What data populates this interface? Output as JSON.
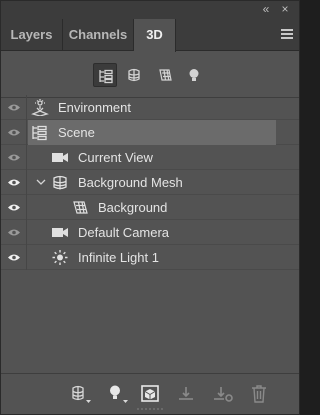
{
  "window": {
    "collapse_glyph": "«",
    "close_glyph": "×"
  },
  "tabs": [
    {
      "label": "Layers",
      "active": false
    },
    {
      "label": "Channels",
      "active": false
    },
    {
      "label": "3D",
      "active": true
    }
  ],
  "filters": [
    {
      "name": "whole-scene-filter",
      "icon": "scene-tree-icon",
      "active": true
    },
    {
      "name": "meshes-filter",
      "icon": "mesh-icon",
      "active": false
    },
    {
      "name": "materials-filter",
      "icon": "material-icon",
      "active": false
    },
    {
      "name": "lights-filter",
      "icon": "light-bulb-icon",
      "active": false
    }
  ],
  "scene_items": [
    {
      "label": "Environment",
      "icon": "environment-icon",
      "eye": "dim",
      "selected": false,
      "level": 0
    },
    {
      "label": "Scene",
      "icon": "scene-tree-icon",
      "eye": "dim",
      "selected": true,
      "level": 0
    },
    {
      "label": "Current View",
      "icon": "camera-icon",
      "eye": "dim",
      "selected": false,
      "level": 1
    },
    {
      "label": "Background Mesh",
      "icon": "mesh-icon",
      "eye": "bright",
      "selected": false,
      "level": 1,
      "expanded": true
    },
    {
      "label": "Background",
      "icon": "material-icon",
      "eye": "bright",
      "selected": false,
      "level": 2
    },
    {
      "label": "Default Camera",
      "icon": "camera-icon",
      "eye": "dim",
      "selected": false,
      "level": 1
    },
    {
      "label": "Infinite Light 1",
      "icon": "sun-light-icon",
      "eye": "bright",
      "selected": false,
      "level": 1
    }
  ],
  "toolbar": [
    {
      "name": "add-mesh-button",
      "icon": "mesh-icon"
    },
    {
      "name": "add-light-button",
      "icon": "light-bulb-icon"
    },
    {
      "name": "render-button",
      "icon": "render-cube-icon"
    },
    {
      "name": "drop-to-ground-button",
      "icon": "ground-icon"
    },
    {
      "name": "drop-to-ground-alt-button",
      "icon": "ground-plus-icon"
    },
    {
      "name": "delete-button",
      "icon": "trash-icon"
    }
  ],
  "colors": {
    "panel_bg": "#535353",
    "tab_bar_bg": "#3c3c3c",
    "selected_row": "#6b6b6b",
    "text": "#e4e4e4"
  }
}
